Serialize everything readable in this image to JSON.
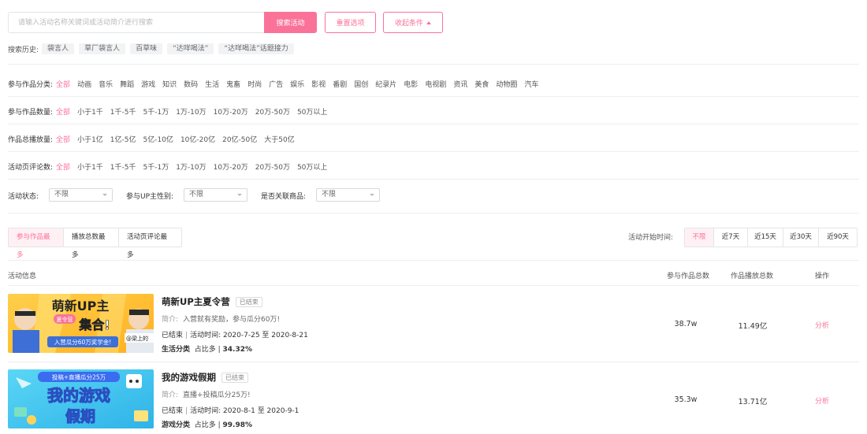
{
  "search": {
    "placeholder": "请输入活动名称关键词或活动简介进行搜索",
    "value": "",
    "search_button": "搜索活动",
    "reset_button": "重置选项",
    "collapse_button": "收起条件"
  },
  "history": {
    "label": "搜索历史:",
    "tags": [
      "袋言人",
      "草厂袋言人",
      "百草味",
      "“达咩喝法”",
      "“达咩喝法”话题接力"
    ]
  },
  "filters": {
    "category": {
      "label": "参与作品分类:",
      "options": [
        "全部",
        "动画",
        "音乐",
        "舞蹈",
        "游戏",
        "知识",
        "数码",
        "生活",
        "鬼畜",
        "时尚",
        "广告",
        "娱乐",
        "影视",
        "番剧",
        "国创",
        "纪录片",
        "电影",
        "电视剧",
        "资讯",
        "美食",
        "动物圈",
        "汽车"
      ]
    },
    "work_count": {
      "label": "参与作品数量:",
      "options": [
        "全部",
        "小于1千",
        "1千-5千",
        "5千-1万",
        "1万-10万",
        "10万-20万",
        "20万-50万",
        "50万以上"
      ]
    },
    "play_count": {
      "label": "作品总播放量:",
      "options": [
        "全部",
        "小于1亿",
        "1亿-5亿",
        "5亿-10亿",
        "10亿-20亿",
        "20亿-50亿",
        "大于50亿"
      ]
    },
    "comment_count": {
      "label": "活动页评论数:",
      "options": [
        "全部",
        "小于1千",
        "1千-5千",
        "5千-1万",
        "1万-10万",
        "10万-20万",
        "20万-50万",
        "50万以上"
      ]
    },
    "status": {
      "label": "活动状态:",
      "value": "不限"
    },
    "gender": {
      "label": "参与UP主性别:",
      "value": "不限"
    },
    "goods": {
      "label": "是否关联商品:",
      "value": "不限"
    }
  },
  "sort_tabs": [
    "参与作品最多",
    "播放总数最多",
    "活动页评论最多"
  ],
  "time_filter": {
    "label": "活动开始时间:",
    "options": [
      "不限",
      "近7天",
      "近15天",
      "近30天",
      "近90天"
    ]
  },
  "table": {
    "headers": {
      "info": "活动信息",
      "works": "参与作品总数",
      "plays": "作品播放总数",
      "action": "操作"
    },
    "rows": [
      {
        "title": "萌新UP主夏令营",
        "badge": "已结束",
        "intro_label": "简介:",
        "intro": "入营就有奖励，参与瓜分60万!",
        "status": "已结束",
        "time_label": "活动时间:",
        "time_range": "2020-7-25 至 2020-8-21",
        "category": "生活分类",
        "share_label": "占比多",
        "share": "34.32%",
        "works": "38.7w",
        "plays": "11.49亿",
        "action": "分析",
        "thumb_text": [
          "萌新UP主",
          "夏令营",
          "集合!",
          "入营瓜分60万奖学金!",
          "@梁上的"
        ]
      },
      {
        "title": "我的游戏假期",
        "badge": "已结束",
        "intro_label": "简介:",
        "intro": "直播+投稿瓜分25万!",
        "status": "已结束",
        "time_label": "活动时间:",
        "time_range": "2020-8-1 至 2020-9-1",
        "category": "游戏分类",
        "share_label": "占比多",
        "share": "99.98%",
        "works": "35.3w",
        "plays": "13.71亿",
        "action": "分析",
        "thumb_text": [
          "投稿+直播瓜分25万",
          "我的游戏",
          "假期"
        ]
      }
    ]
  },
  "colors": {
    "accent": "#fb7299",
    "accent_bg": "#fff0f4",
    "divider": "#eceef0"
  }
}
